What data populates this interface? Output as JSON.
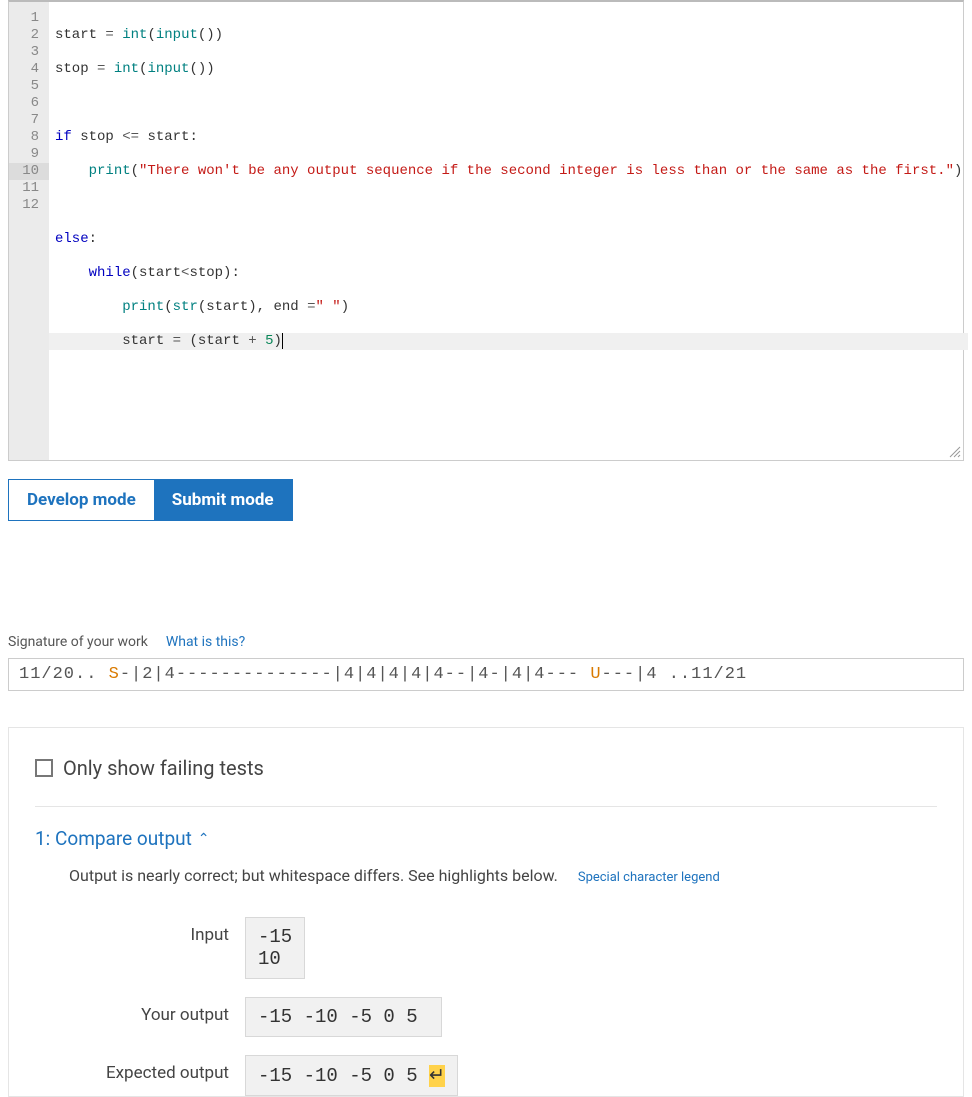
{
  "editor": {
    "line_count": 12,
    "active_line": 10,
    "lines": {
      "l1": {
        "a": "start ",
        "b": "=",
        "c": " ",
        "d": "int",
        "e": "(",
        "f": "input",
        "g": "())"
      },
      "l2": {
        "a": "stop ",
        "b": "=",
        "c": " ",
        "d": "int",
        "e": "(",
        "f": "input",
        "g": "())"
      },
      "l4": {
        "a": "if",
        "b": " stop ",
        "c": "<=",
        "d": " start:"
      },
      "l5": {
        "pad": "    ",
        "a": "print",
        "b": "(",
        "c": "\"There won't be any output sequence if the second integer is less than or the same as the first.\"",
        "d": ")"
      },
      "l7": {
        "a": "else",
        "b": ":"
      },
      "l8": {
        "pad": "    ",
        "a": "while",
        "b": "(start",
        "c": "<",
        "d": "stop):"
      },
      "l9": {
        "pad": "        ",
        "a": "print",
        "b": "(",
        "c": "str",
        "d": "(start), end ",
        "e": "=",
        "f": "\" \"",
        "g": ")"
      },
      "l10": {
        "pad": "        ",
        "a": "start ",
        "b": "=",
        "c": " (start ",
        "d": "+",
        "e": " ",
        "f": "5",
        "g": ")"
      }
    }
  },
  "modes": {
    "develop": "Develop mode",
    "submit": "Submit mode"
  },
  "signature": {
    "label": "Signature of your work",
    "help": "What is this?",
    "pre": "11/20.. ",
    "s": "S",
    "mid": "-|2|4--------------|4|4|4|4|4--|4-|4|4--- ",
    "u": "U",
    "post": "---|4 ..11/21"
  },
  "results": {
    "only_failing": "Only show failing tests",
    "test1": {
      "title": "1: Compare output",
      "msg": "Output is nearly correct; but whitespace differs. See highlights below.",
      "legend": "Special character legend",
      "labels": {
        "input": "Input",
        "your": "Your output",
        "expected": "Expected output"
      },
      "input": "-15\n10",
      "your_output": "-15 -10 -5 0 5 ",
      "expected_output_prefix": "-15 -10 -5 0 5 ",
      "expected_output_hl": "↵"
    }
  }
}
